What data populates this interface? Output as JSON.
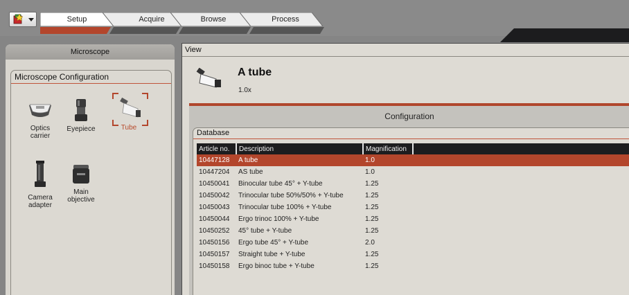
{
  "tabs": [
    {
      "label": "Setup",
      "active": true
    },
    {
      "label": "Acquire",
      "active": false
    },
    {
      "label": "Browse",
      "active": false
    },
    {
      "label": "Process",
      "active": false
    }
  ],
  "left_panel": {
    "title": "Microscope",
    "group_title": "Microscope Configuration",
    "components": [
      {
        "label": "Optics carrier",
        "icon": "optics-carrier-icon",
        "active": false
      },
      {
        "label": "Eyepiece",
        "icon": "eyepiece-icon",
        "active": false
      },
      {
        "label": "Tube",
        "icon": "tube-icon",
        "active": true
      },
      {
        "label": "Camera adapter",
        "icon": "camera-adapter-icon",
        "active": false
      },
      {
        "label": "Main objective",
        "icon": "main-objective-icon",
        "active": false
      }
    ]
  },
  "view": {
    "label": "View",
    "title": "A tube",
    "magnification": "1.0x"
  },
  "configuration": {
    "title": "Configuration",
    "database_label": "Database",
    "columns": [
      "Article no.",
      "Description",
      "Magnification"
    ],
    "rows": [
      {
        "article": "10447128",
        "description": "A tube",
        "magnification": "1.0",
        "selected": true
      },
      {
        "article": "10447204",
        "description": "AS tube",
        "magnification": "1.0",
        "selected": false
      },
      {
        "article": "10450041",
        "description": "Binocular tube 45° + Y-tube",
        "magnification": "1.25",
        "selected": false
      },
      {
        "article": "10450042",
        "description": "Trinocular tube 50%/50% + Y-tube",
        "magnification": "1.25",
        "selected": false
      },
      {
        "article": "10450043",
        "description": "Trinocular tube 100% + Y-tube",
        "magnification": "1.25",
        "selected": false
      },
      {
        "article": "10450044",
        "description": "Ergo trinoc 100% + Y-tube",
        "magnification": "1.25",
        "selected": false
      },
      {
        "article": "10450252",
        "description": "45° tube + Y-tube",
        "magnification": "1.25",
        "selected": false
      },
      {
        "article": "10450156",
        "description": "Ergo tube 45° + Y-tube",
        "magnification": "2.0",
        "selected": false
      },
      {
        "article": "10450157",
        "description": "Straight tube + Y-tube",
        "magnification": "1.25",
        "selected": false
      },
      {
        "article": "10450158",
        "description": "Ergo binoc tube + Y-tube",
        "magnification": "1.25",
        "selected": false
      }
    ]
  },
  "colors": {
    "accent": "#b3462c",
    "header_dark": "#1d1d1f",
    "panel_bg": "#dedbd4"
  }
}
